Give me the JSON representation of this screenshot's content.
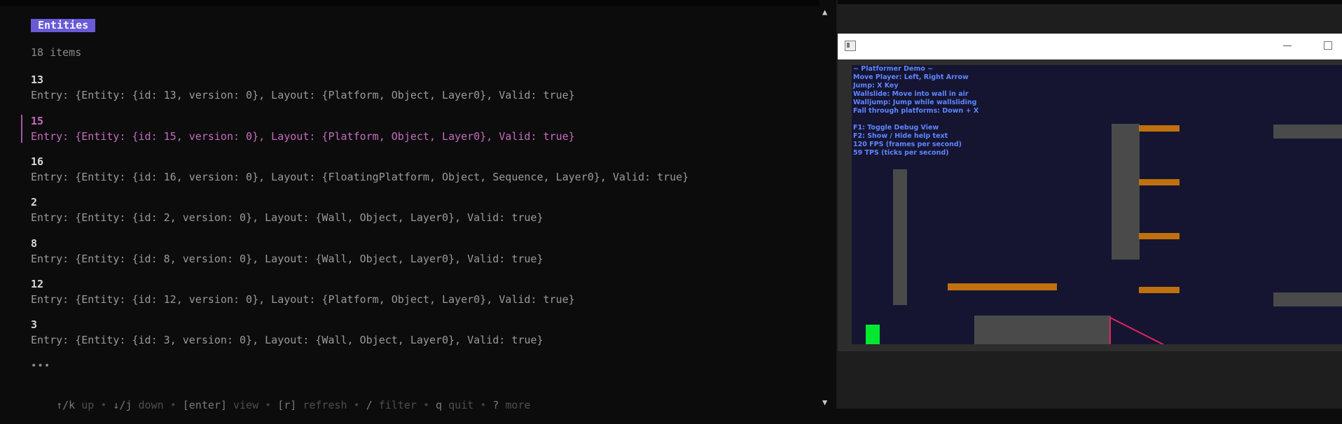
{
  "list": {
    "title": "Entities",
    "count_text": "18 items",
    "items": [
      {
        "id": "13",
        "entry": "Entry: {Entity: {id: 13, version: 0}, Layout: {Platform, Object, Layer0}, Valid: true}"
      },
      {
        "id": "15",
        "entry": "Entry: {Entity: {id: 15, version: 0}, Layout: {Platform, Object, Layer0}, Valid: true}"
      },
      {
        "id": "16",
        "entry": "Entry: {Entity: {id: 16, version: 0}, Layout: {FloatingPlatform, Object, Sequence, Layer0}, Valid: true}"
      },
      {
        "id": "2",
        "entry": "Entry: {Entity: {id: 2, version: 0}, Layout: {Wall, Object, Layer0}, Valid: true}"
      },
      {
        "id": "8",
        "entry": "Entry: {Entity: {id: 8, version: 0}, Layout: {Wall, Object, Layer0}, Valid: true}"
      },
      {
        "id": "12",
        "entry": "Entry: {Entity: {id: 12, version: 0}, Layout: {Platform, Object, Layer0}, Valid: true}"
      },
      {
        "id": "3",
        "entry": "Entry: {Entity: {id: 3, version: 0}, Layout: {Wall, Object, Layer0}, Valid: true}"
      }
    ],
    "selected_id": "15",
    "more_indicator": "•••"
  },
  "help": {
    "k1": "↑/k",
    "d1": "up",
    "k2": "↓/j",
    "d2": "down",
    "k3": "[enter]",
    "d3": "view",
    "k4": "[r]",
    "d4": "refresh",
    "k5": "/",
    "d5": "filter",
    "k6": "q",
    "d6": "quit",
    "k7": "?",
    "d7": "more",
    "sep": "•"
  },
  "game": {
    "overlay": [
      "~ Platformer Demo ~",
      "Move Player: Left, Right Arrow",
      "Jump: X Key",
      "Wallslide: Move into wall in air",
      "Walljump: Jump while wallsliding",
      "Fall through platforms: Down + X",
      "",
      "F1: Toggle Debug View",
      "F2: Show / Hide help text",
      "120 FPS (frames per second)",
      "59 TPS (ticks per second)"
    ]
  },
  "colors": {
    "accent": "#6a5ad6",
    "selected": "#c66bc0",
    "player": "#00e830",
    "platform": "#c0710e",
    "game_bg": "#151532",
    "overlay_text": "#5f86ff"
  }
}
